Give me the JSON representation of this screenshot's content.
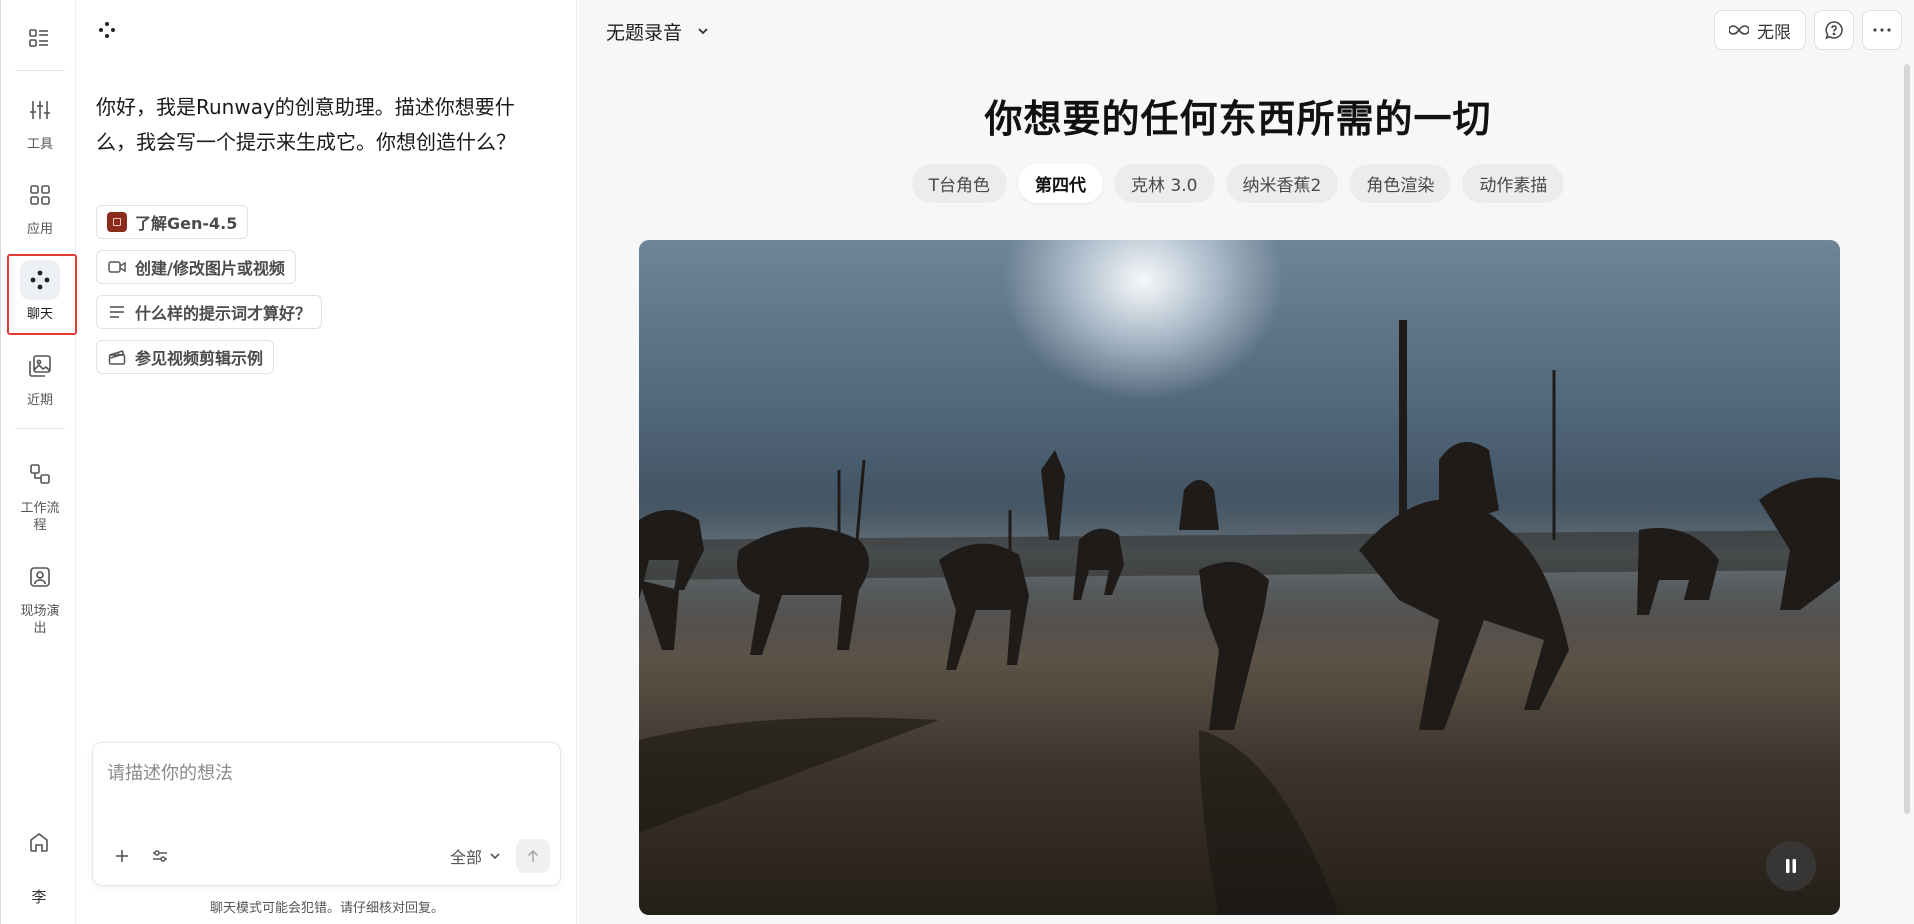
{
  "rail": {
    "items": [
      {
        "label": "工具",
        "icon": "sliders-icon"
      },
      {
        "label": "应用",
        "icon": "apps-grid-icon"
      },
      {
        "label": "聊天",
        "icon": "chat-dots-icon",
        "active": true
      },
      {
        "label": "近期",
        "icon": "recent-images-icon"
      },
      {
        "label": "工作流程",
        "icon": "workflow-icon"
      },
      {
        "label": "现场演出",
        "icon": "live-icon"
      }
    ],
    "avatar": "李"
  },
  "chat": {
    "greeting": "你好，我是Runway的创意助理。描述你想要什么，我会写一个提示来生成它。你想创造什么？",
    "suggestions": [
      {
        "label": "了解Gen-4.5",
        "icon": "gen-badge-icon"
      },
      {
        "label": "创建/修改图片或视频",
        "icon": "video-camera-icon"
      },
      {
        "label": "什么样的提示词才算好？",
        "icon": "lines-icon"
      },
      {
        "label": "参见视频剪辑示例",
        "icon": "clapperboard-icon"
      }
    ],
    "composer": {
      "placeholder": "请描述你的想法",
      "scope": "全部"
    },
    "disclaimer": "聊天模式可能会犯错。请仔细核对回复。"
  },
  "main": {
    "recording_title": "无题录音",
    "actions": {
      "unlimited_label": "无限"
    },
    "hero_title": "你想要的任何东西所需的一切",
    "tabs": [
      {
        "label": "T台角色"
      },
      {
        "label": "第四代",
        "active": true
      },
      {
        "label": "克林 3.0"
      },
      {
        "label": "纳米香蕉2"
      },
      {
        "label": "角色渲染"
      },
      {
        "label": "动作素描"
      }
    ]
  }
}
